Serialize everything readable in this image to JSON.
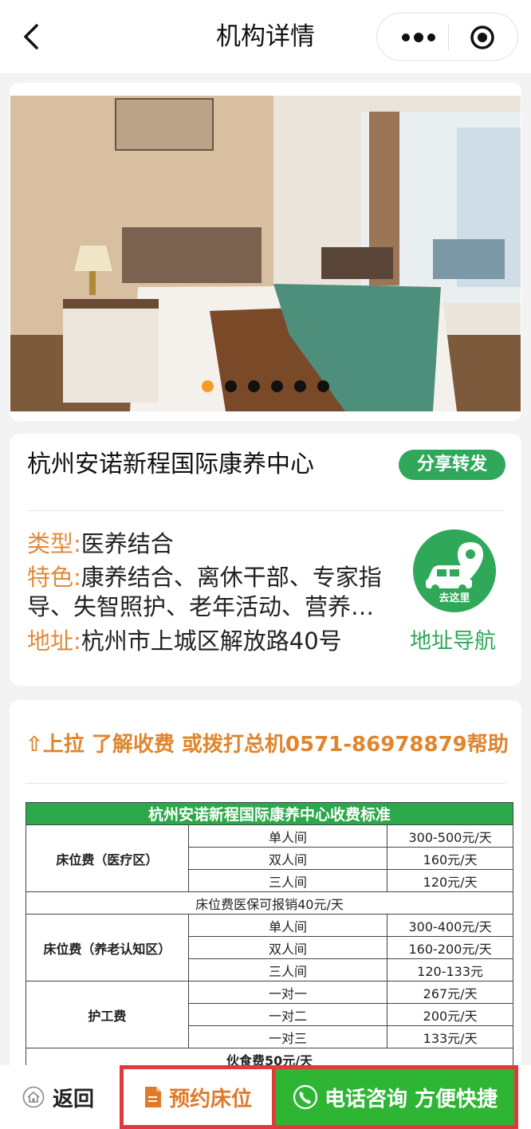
{
  "nav": {
    "title": "机构详情"
  },
  "banner": {
    "slide_count": 6,
    "active_index": 0
  },
  "org": {
    "name": "杭州安诺新程国际康养中心",
    "share_label": "分享转发",
    "type_label": "类型:",
    "type_value": "医养结合",
    "feature_label": "特色:",
    "feature_value": "康养结合、离休干部、专家指导、失智照护、老年活动、营养…",
    "address_label": "地址:",
    "address_value": "杭州市上城区解放路40号",
    "go_here": "去这里",
    "nav_label": "地址导航"
  },
  "fees": {
    "tip": "⇧上拉 了解收费 或拨打总机0571-86978879帮助",
    "table_title": "杭州安诺新程国际康养中心收费标准",
    "medical": {
      "category": "床位费（医疗区）",
      "rows": [
        {
          "room": "单人间",
          "price": "300-500元/天"
        },
        {
          "room": "双人间",
          "price": "160元/天"
        },
        {
          "room": "三人间",
          "price": "120元/天"
        }
      ]
    },
    "insurance_note": "床位费医保可报销40元/天",
    "dementia": {
      "category": "床位费（养老认知区）",
      "rows": [
        {
          "room": "单人间",
          "price": "300-400元/天"
        },
        {
          "room": "双人间",
          "price": "160-200元/天"
        },
        {
          "room": "三人间",
          "price": "120-133元"
        }
      ]
    },
    "nursing": {
      "category": "护工费",
      "rows": [
        {
          "room": "一对一",
          "price": "267元/天"
        },
        {
          "room": "一对二",
          "price": "200元/天"
        },
        {
          "room": "一对三",
          "price": "133元/天"
        }
      ]
    },
    "meal": "伙食费50元/天"
  },
  "bottom": {
    "home_label": "返回",
    "book_label": "预约床位",
    "call_label": "电话咨询 方便快捷"
  },
  "colors": {
    "green": "#2fa85a",
    "orange": "#e08a3c",
    "highlight": "#e23a3a"
  }
}
